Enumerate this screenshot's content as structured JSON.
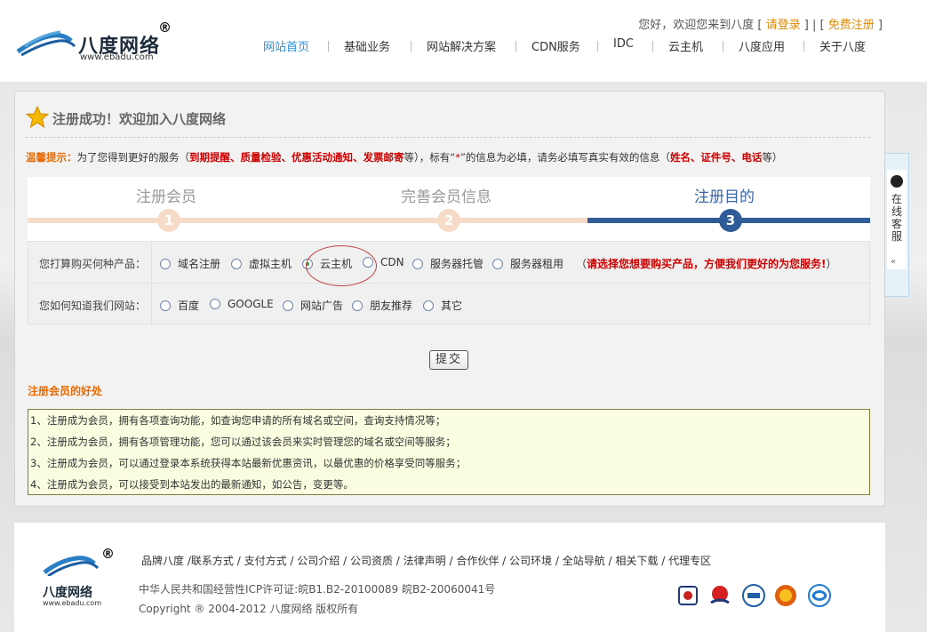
{
  "header": {
    "logo_name": "八度网络",
    "logo_url": "www.ebadu.com",
    "logo_reg": "®",
    "greeting": "您好，欢迎您来到八度",
    "bracket_open": "[",
    "bracket_close": "]",
    "pipe": "|",
    "login": "请登录",
    "register": "免费注册",
    "nav": [
      "网站首页",
      "基础业务",
      "网站解决方案",
      "CDN服务",
      "IDC",
      "云主机",
      "八度应用",
      "关于八度"
    ]
  },
  "page": {
    "title": "注册成功！欢迎加入八度网络",
    "tips": {
      "label": "温馨提示：",
      "t1": "为了您得到更好的服务（",
      "r1": "到期提醒、质量检验、优惠活动通知、发票邮寄",
      "t2": "等），标有“",
      "star": "*",
      "t3": "”的信息为必填，请务必填写真实有效的信息（",
      "r2": "姓名、证件号、电话",
      "t4": "等）"
    },
    "steps": [
      {
        "label": "注册会员",
        "num": "1"
      },
      {
        "label": "完善会员信息",
        "num": "2"
      },
      {
        "label": "注册目的",
        "num": "3"
      }
    ],
    "form": {
      "q1": "您打算购买何种产品：",
      "q1_options": [
        "域名注册",
        "虚拟主机",
        "云主机",
        "CDN",
        "服务器托管",
        "服务器租用"
      ],
      "q1_selected": "云主机",
      "hint_open": "（",
      "hint": "请选择您想要购买产品，方便我们更好的为您服务",
      "hint_mark": "!",
      "hint_close": "）",
      "q2": "您如何知道我们网站：",
      "q2_options": [
        "百度",
        "GOOGLE",
        "网站广告",
        "朋友推荐",
        "其它"
      ]
    },
    "submit": "提交",
    "benefits_title": "注册会员的好处",
    "benefits": [
      "1、注册成为会员，拥有各项查询功能，如查询您申请的所有域名或空间，查询支持情况等；",
      "2、注册成为会员，拥有各项管理功能，您可以通过该会员来实时管理您的域名或空间等服务；",
      "3、注册成为会员，可以通过登录本系统获得本站最新优惠资讯，以最优惠的价格享受同等服务；",
      "4、注册成为会员，可以接受到本站发出的最新通知，如公告，变更等。"
    ]
  },
  "sidetab": {
    "label": "在线客服",
    "arrow": "«"
  },
  "footer": {
    "logo_name": "八度网络",
    "logo_url": "www.ebadu.com",
    "links": [
      "品牌八度",
      "联系方式",
      "支付方式",
      "公司介绍",
      "公司资质",
      "法律声明",
      "合作伙伴",
      "公司环境",
      "全站导航",
      "相关下载",
      "代理专区"
    ],
    "icp": "中华人民共和国经营性ICP许可证:皖B1.B2-20100089  皖B2-20060041号",
    "copyright": "Copyright ® 2004-2012 八度网络 版权所有"
  },
  "colors": {
    "accent_blue": "#2a8fd6",
    "orange": "#e08a00",
    "step_active": "#2f5c98",
    "step_inactive": "#f6dcc8",
    "required_red": "#cc0000"
  }
}
